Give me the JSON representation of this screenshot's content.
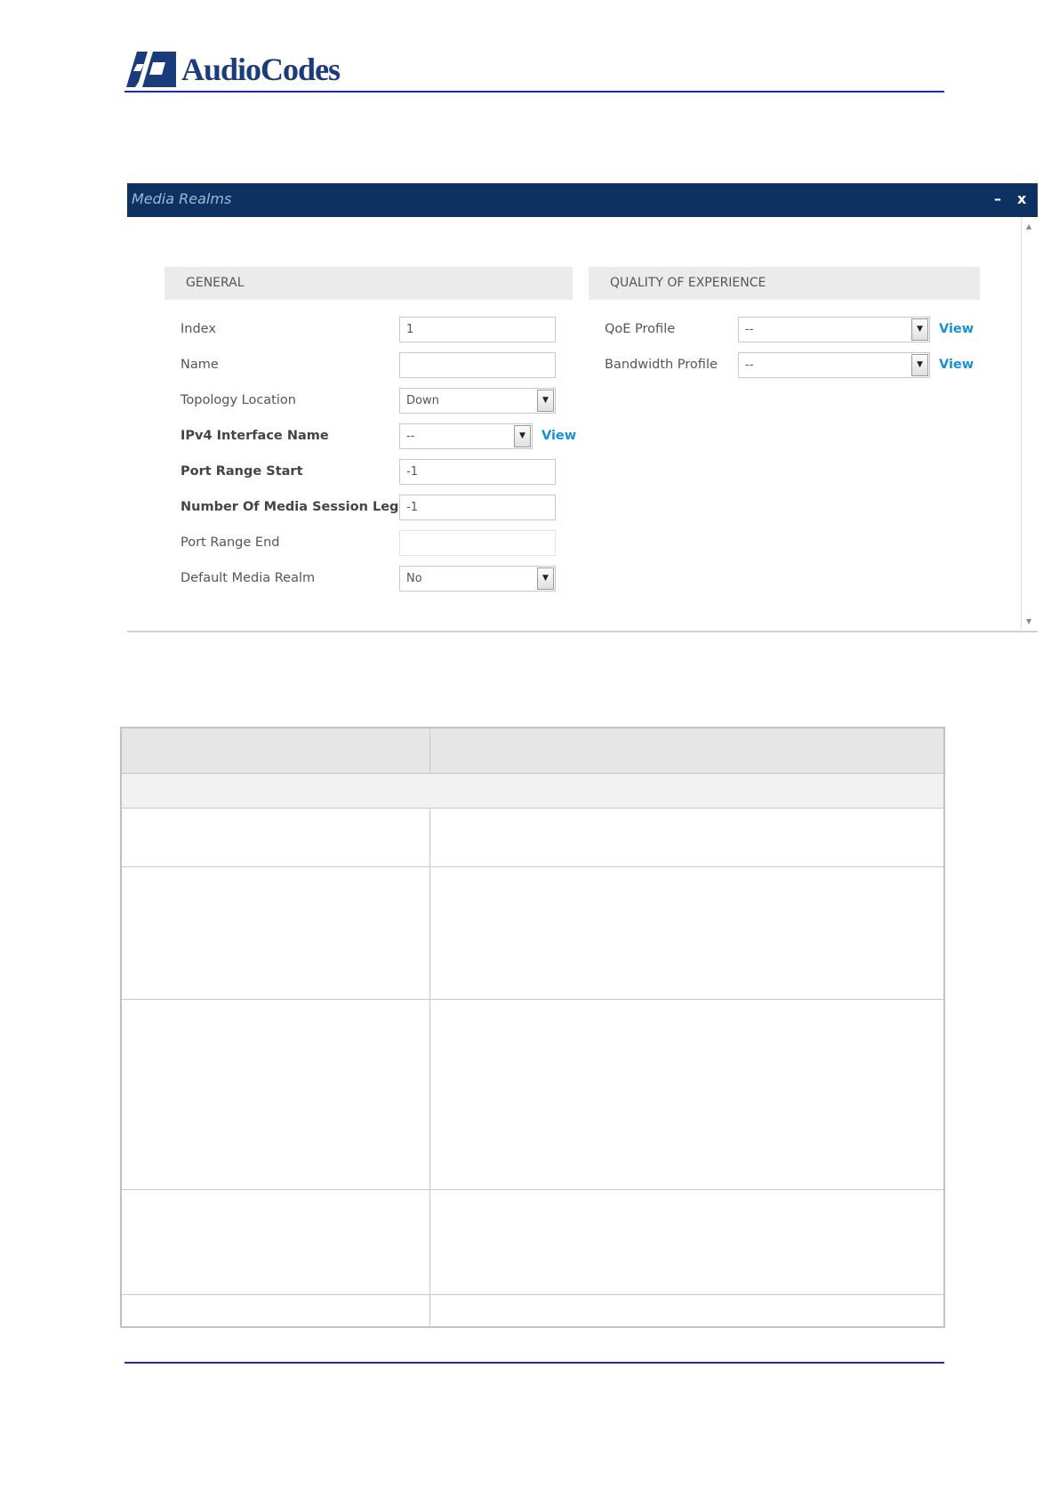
{
  "header": {
    "logo_text": "AudioCodes",
    "logo_mark": "audiocodes-logo-mark"
  },
  "dialog": {
    "title": "Media Realms",
    "minimize_label": "–",
    "close_label": "x",
    "sections": {
      "general": "GENERAL",
      "qoe": "QUALITY OF EXPERIENCE"
    },
    "general_fields": {
      "index": {
        "label": "Index",
        "value": "1"
      },
      "name": {
        "label": "Name",
        "value": ""
      },
      "topology_location": {
        "label": "Topology Location",
        "value": "Down"
      },
      "ipv4_interface_name": {
        "label": "IPv4 Interface Name",
        "value": "--",
        "link": "View"
      },
      "port_range_start": {
        "label": "Port Range Start",
        "value": "-1"
      },
      "media_session_legs": {
        "label": "Number Of Media Session Legs",
        "value": "-1"
      },
      "port_range_end": {
        "label": "Port Range End",
        "value": ""
      },
      "default_media_realm": {
        "label": "Default Media Realm",
        "value": "No"
      }
    },
    "qoe_fields": {
      "qoe_profile": {
        "label": "QoE Profile",
        "value": "--",
        "link": "View"
      },
      "bandwidth_profile": {
        "label": "Bandwidth Profile",
        "value": "--",
        "link": "View"
      }
    },
    "icons": {
      "dropdown": "chevron-down-icon",
      "scroll_up": "scroll-up-icon",
      "scroll_down": "scroll-down-icon"
    }
  },
  "colors": {
    "titlebar": "#0d3160",
    "link": "#1b8fd6",
    "rule": "#1f2bb0",
    "logo": "#1b3c7a"
  }
}
